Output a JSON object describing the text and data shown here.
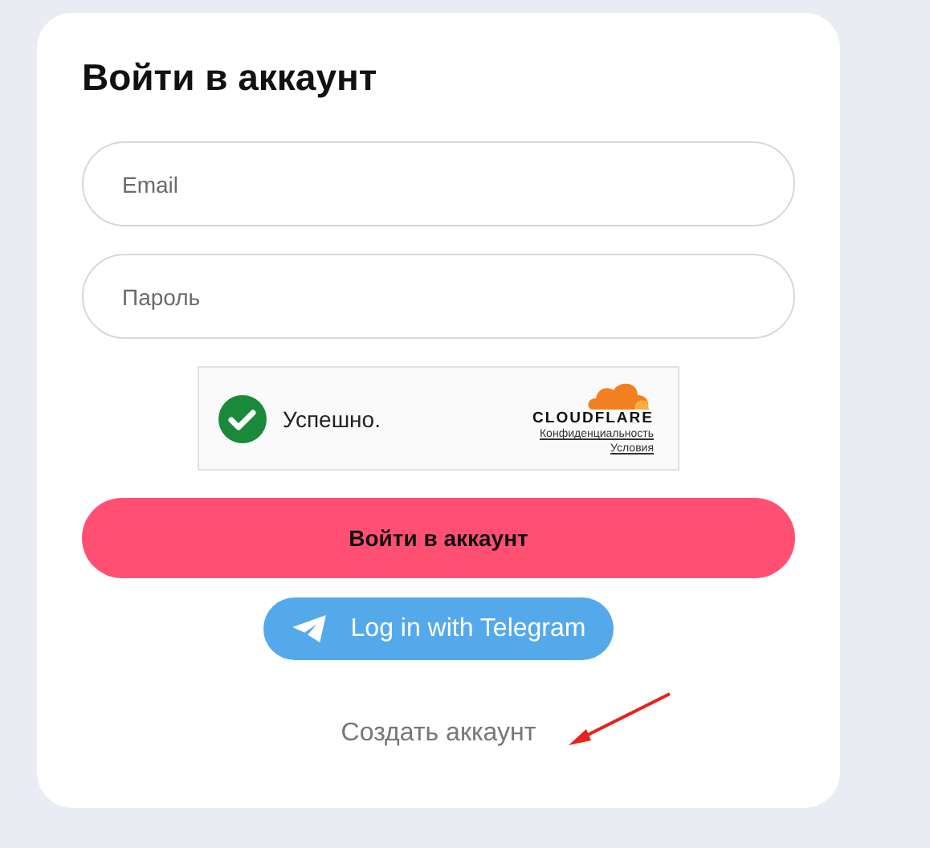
{
  "title": "Войти в аккаунт",
  "fields": [
    {
      "placeholder": "Email"
    },
    {
      "placeholder": "Пароль"
    }
  ],
  "captcha": {
    "status": "Успешно.",
    "brand": "CLOUDFLARE",
    "links": [
      "Конфиденциальность",
      "Условия"
    ]
  },
  "submit_button": "Войти в аккаунт",
  "telegram_button": "Log in with Telegram",
  "create_account_link": "Создать аккаунт"
}
